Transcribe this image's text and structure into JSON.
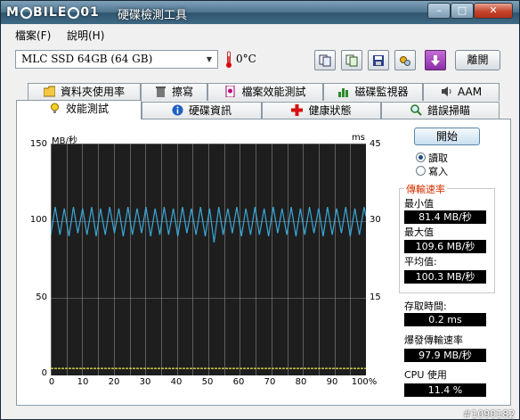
{
  "titlebar": {
    "logo_left": "M",
    "logo_mid": "BILE",
    "logo_right": "01",
    "title": "硬碟檢測工具",
    "min_symbol": "–",
    "max_symbol": "□",
    "close_symbol": "✕"
  },
  "menu": {
    "file": "檔案(F)",
    "help": "說明(H)"
  },
  "toolbar": {
    "device": "MLC SSD 64GB (64 GB)",
    "temperature": "0°C",
    "exit_label": "離開"
  },
  "tabs": {
    "row1": [
      "資料夾使用率",
      "擦寫",
      "檔案效能測試",
      "磁碟監視器",
      "AAM"
    ],
    "row2": [
      "效能測試",
      "硬碟資訊",
      "健康狀態",
      "錯誤掃瞄"
    ]
  },
  "chart": {
    "unit_left": "MB/秒",
    "unit_right": "ms",
    "y_left_ticks": [
      "150",
      "100",
      "50",
      "0"
    ],
    "y_right_ticks": [
      "45",
      "30",
      "15"
    ],
    "x_ticks": [
      "0",
      "10",
      "20",
      "30",
      "40",
      "50",
      "60",
      "70",
      "80",
      "90",
      "100%"
    ]
  },
  "chart_data": {
    "type": "line",
    "x": [
      0,
      1.4,
      2.9,
      4.3,
      5.8,
      7.2,
      8.6,
      10.1,
      11.5,
      13.0,
      14.4,
      15.8,
      17.3,
      18.7,
      20.2,
      21.6,
      23.0,
      24.5,
      25.9,
      27.4,
      28.8,
      30.2,
      31.7,
      33.1,
      34.6,
      36.0,
      37.4,
      38.9,
      40.3,
      41.8,
      43.2,
      44.6,
      46.1,
      47.5,
      49.0,
      50.4,
      51.8,
      53.3,
      54.7,
      56.2,
      57.6,
      59.0,
      60.5,
      61.9,
      63.4,
      64.8,
      66.2,
      67.7,
      69.1,
      70.6,
      72.0,
      73.4,
      74.9,
      76.3,
      77.8,
      79.2,
      80.6,
      82.1,
      83.5,
      85.0,
      86.4,
      87.8,
      89.3,
      90.7,
      92.2,
      93.6,
      95.0,
      96.5,
      97.9,
      99.4,
      100
    ],
    "series": [
      {
        "values": [
          91,
          109,
          91,
          108,
          90,
          109,
          92,
          108,
          91,
          109,
          90,
          108,
          91,
          109,
          92,
          108,
          90,
          109,
          91,
          108,
          92,
          109,
          90,
          108,
          91,
          109,
          91,
          108,
          90,
          109,
          92,
          108,
          91,
          109,
          90,
          108,
          86,
          109,
          91,
          108,
          92,
          109,
          90,
          108,
          91,
          109,
          91,
          108,
          90,
          109,
          92,
          108,
          91,
          109,
          90,
          108,
          91,
          109,
          92,
          108,
          90,
          109,
          91,
          108,
          92,
          109,
          90,
          108,
          91,
          109,
          103
        ]
      },
      {
        "values": [
          1,
          1,
          1,
          1,
          1,
          1,
          1,
          1,
          1,
          1,
          1
        ]
      }
    ],
    "x_ticks": [
      0,
      10,
      20,
      30,
      40,
      50,
      60,
      70,
      80,
      90,
      100
    ],
    "ylim": [
      0,
      150
    ],
    "y2lim": [
      0,
      45
    ],
    "xlim": [
      0,
      100
    ],
    "grid": true,
    "colors": {
      "read": "#3aa8d8",
      "access": "#d8d840",
      "background": "#1e1e1e",
      "grid": "#8a8a8a"
    }
  },
  "controls": {
    "start_label": "開始",
    "read_label": "讀取",
    "write_label": "寫入",
    "selected": "read"
  },
  "stats": {
    "group_title": "傳輸速率",
    "min_label": "最小值",
    "min_value": "81.4 MB/秒",
    "max_label": "最大值",
    "max_value": "109.6 MB/秒",
    "avg_label": "平均值:",
    "avg_value": "100.3 MB/秒",
    "access_label": "存取時間:",
    "access_value": "0.2 ms",
    "burst_label": "爆發傳輸速率",
    "burst_value": "97.9 MB/秒",
    "cpu_label": "CPU 使用",
    "cpu_value": "11.4 %"
  },
  "watermark": "#1090182"
}
